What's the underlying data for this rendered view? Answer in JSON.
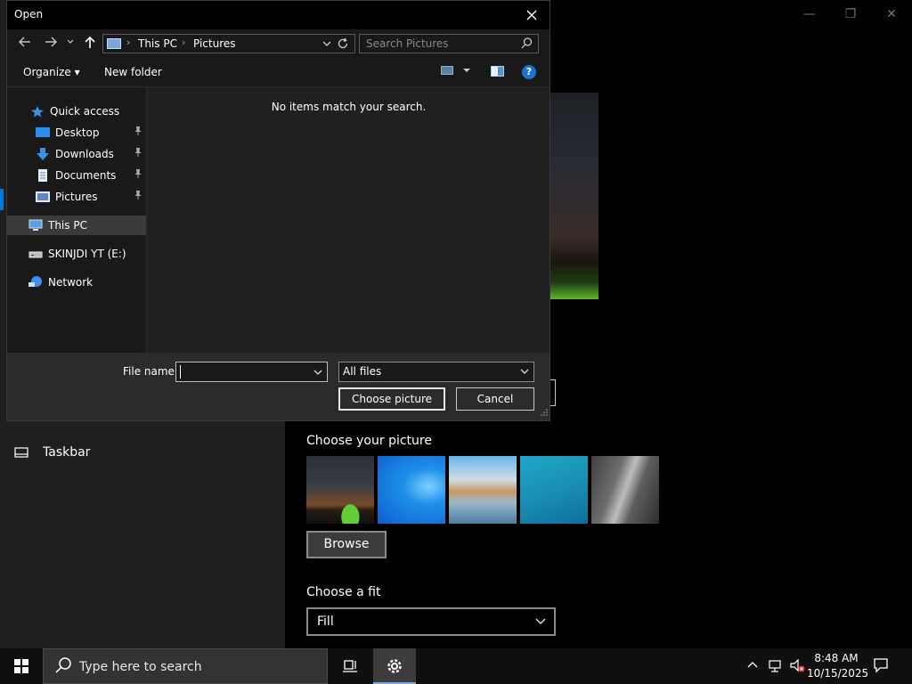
{
  "settings": {
    "controls": {
      "minimize": "—",
      "maximize": "❐",
      "close": "✕"
    },
    "sidebar": {
      "taskbar_label": "Taskbar"
    },
    "main": {
      "choose_picture_label": "Choose your picture",
      "browse_label": "Browse",
      "choose_fit_label": "Choose a fit",
      "fit_value": "Fill"
    }
  },
  "dialog": {
    "title": "Open",
    "address": {
      "crumbs": [
        "This PC",
        "Pictures"
      ],
      "separator": "›"
    },
    "search": {
      "placeholder": "Search Pictures"
    },
    "commands": {
      "organize": "Organize ▾",
      "new_folder": "New folder"
    },
    "nav": {
      "quick_access": "Quick access",
      "desktop": "Desktop",
      "downloads": "Downloads",
      "documents": "Documents",
      "pictures": "Pictures",
      "this_pc": "This PC",
      "drive_e": "SKINJDI YT (E:)",
      "network": "Network"
    },
    "empty_message": "No items match your search.",
    "footer": {
      "file_name_label": "File name:",
      "file_name_value": "",
      "file_type_value": "All files",
      "choose_label": "Choose picture",
      "cancel_label": "Cancel"
    }
  },
  "taskbar": {
    "search_placeholder": "Type here to search",
    "clock_time": "8:48 AM",
    "clock_date": "10/15/2025"
  },
  "colors": {
    "accent": "#0078d7",
    "dialog_bg": "#202020",
    "nav_bg": "#191919"
  }
}
